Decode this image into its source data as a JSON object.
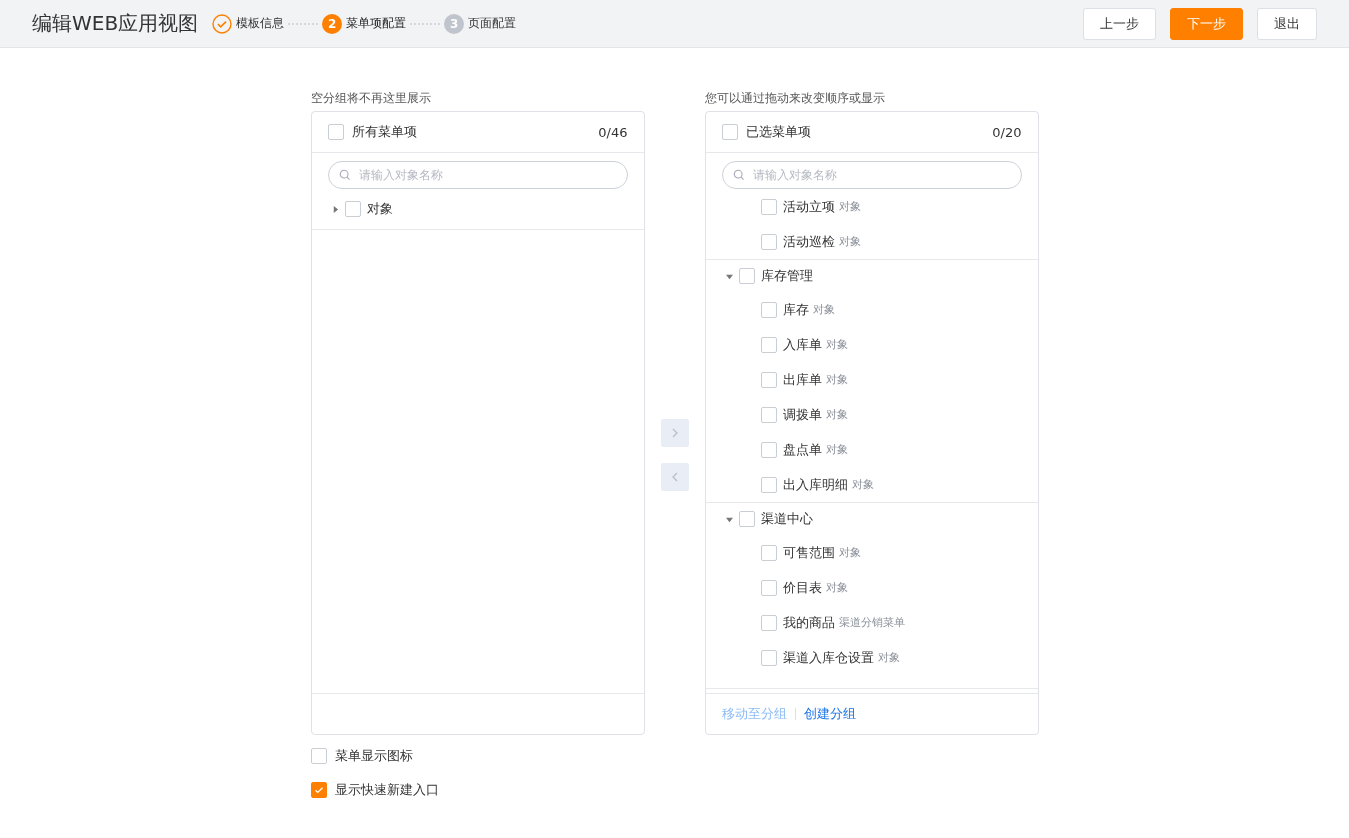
{
  "header": {
    "title": "编辑WEB应用视图",
    "steps": [
      {
        "label": "模板信息",
        "done": true,
        "selected": false
      },
      {
        "label": "菜单项配置",
        "done": false,
        "selected": true,
        "number": "2"
      },
      {
        "label": "页面配置",
        "done": false,
        "selected": false,
        "number": "3"
      }
    ],
    "buttons": [
      {
        "label": "上一步",
        "kind": "default"
      },
      {
        "label": "下一步",
        "kind": "primary"
      },
      {
        "label": "退出",
        "kind": "default"
      }
    ]
  },
  "source": {
    "caption": "空分组将不再这里展示",
    "title": "所有菜单项",
    "checked": false,
    "count": "0/46",
    "search_placeholder": "请输入对象名称",
    "tree": [
      {
        "label": "对象",
        "expanded": false,
        "checked": false
      }
    ]
  },
  "transfer": {
    "to_right_disabled": true,
    "to_left_disabled": true
  },
  "target": {
    "caption": "您可以通过拖动来改变顺序或显示",
    "title": "已选菜单项",
    "checked": false,
    "count": "0/20",
    "search_placeholder": "请输入对象名称",
    "loose_items": [
      {
        "label": "活动立项",
        "tag": "对象",
        "checked": false
      },
      {
        "label": "活动巡检",
        "tag": "对象",
        "checked": false
      }
    ],
    "groups": [
      {
        "label": "库存管理",
        "expanded": true,
        "checked": false,
        "items": [
          {
            "label": "库存",
            "tag": "对象",
            "checked": false
          },
          {
            "label": "入库单",
            "tag": "对象",
            "checked": false
          },
          {
            "label": "出库单",
            "tag": "对象",
            "checked": false
          },
          {
            "label": "调拨单",
            "tag": "对象",
            "checked": false
          },
          {
            "label": "盘点单",
            "tag": "对象",
            "checked": false
          },
          {
            "label": "出入库明细",
            "tag": "对象",
            "checked": false
          }
        ]
      },
      {
        "label": "渠道中心",
        "expanded": true,
        "checked": false,
        "items": [
          {
            "label": "可售范围",
            "tag": "对象",
            "checked": false
          },
          {
            "label": "价目表",
            "tag": "对象",
            "checked": false
          },
          {
            "label": "我的商品",
            "tag": "渠道分销菜单",
            "checked": false
          },
          {
            "label": "渠道入库仓设置",
            "tag": "对象",
            "checked": false
          }
        ]
      }
    ],
    "footer_links": [
      {
        "label": "移动至分组",
        "disabled": true
      },
      {
        "label": "创建分组",
        "disabled": false
      }
    ]
  },
  "options": [
    {
      "label": "菜单显示图标",
      "checked": false
    },
    {
      "label": "显示快速新建入口",
      "checked": true
    }
  ]
}
